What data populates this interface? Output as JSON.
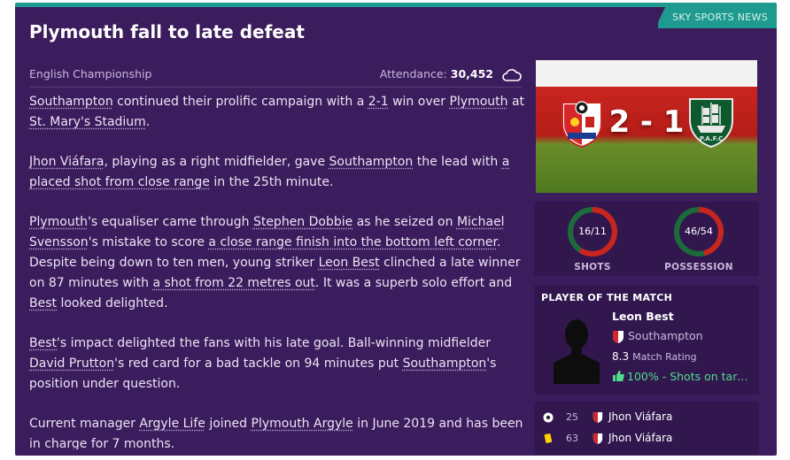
{
  "source": "SKY SPORTS NEWS",
  "headline": "Plymouth fall to late defeat",
  "meta": {
    "competition": "English Championship",
    "attendance_label": "Attendance:",
    "attendance_value": "30,452",
    "weather_icon": "cloud-icon"
  },
  "article": {
    "p1": {
      "home_team": "Southampton",
      "t1": " continued their prolific campaign with a ",
      "score": "2-1",
      "t2": " win over ",
      "away_team": "Plymouth",
      "t3": " at ",
      "venue": "St. Mary's Stadium",
      "t4": "."
    },
    "p2": {
      "player": "Jhon Viáfara",
      "t1": ", playing as a right midfielder, gave ",
      "team": "Southampton",
      "t2": " the lead with ",
      "goal_desc": "a placed shot from close range",
      "t3": " in the 25th minute."
    },
    "p3": {
      "team": "Plymouth",
      "t1": "'s equaliser came through ",
      "player1": "Stephen Dobbie",
      "t2": " as he seized on ",
      "player2": "Michael Svensson",
      "t3": "'s mistake to score ",
      "goal_desc": "a close range finish into the bottom left corner",
      "t4": ". Despite being down to ten men, young striker ",
      "player3": "Leon Best",
      "t5": " clinched a late winner on 87 minutes with ",
      "goal_desc2": "a shot from 22 metres out",
      "t6": ". It was a superb solo effort and ",
      "player4": "Best",
      "t7": " looked delighted."
    },
    "p4": {
      "player1": "Best",
      "t1": "'s impact delighted the fans with his late goal. Ball-winning midfielder ",
      "player2": "David Prutton",
      "t2": "'s red card for a bad tackle on 94 minutes put ",
      "team": "Southampton",
      "t3": "'s position under question."
    },
    "p5": {
      "t1": "Current manager ",
      "manager": "Argyle Life",
      "t2": " joined ",
      "team": "Plymouth Argyle",
      "t3": " in June 2019 and has been in charge for 7 months."
    }
  },
  "score_panel": {
    "score": "2 - 1",
    "home_badge_icon": "southampton-crest-icon",
    "away_badge_icon": "plymouth-crest-icon"
  },
  "stats": {
    "shots": {
      "label": "SHOTS",
      "value": "16/11",
      "home": 16,
      "away": 11
    },
    "possession": {
      "label": "POSSESSION",
      "value": "46/54",
      "home": 46,
      "away": 54
    }
  },
  "potm": {
    "heading": "PLAYER OF THE MATCH",
    "name": "Leon Best",
    "club": "Southampton",
    "rating": "8.3",
    "rating_label": "Match Rating",
    "highlight": "100% - Shots on targe..."
  },
  "events": [
    {
      "icon": "football-icon",
      "minute": "25",
      "player": "Jhon Viáfara"
    },
    {
      "icon": "yellow-card-icon",
      "minute": "63",
      "player": "Jhon Viáfara"
    }
  ],
  "colors": {
    "background": "#3b1c5c",
    "accent": "#1e9a8f",
    "home_ring": "#c9251f",
    "away_ring": "#1c6b3a",
    "positive": "#4fdc8b"
  }
}
